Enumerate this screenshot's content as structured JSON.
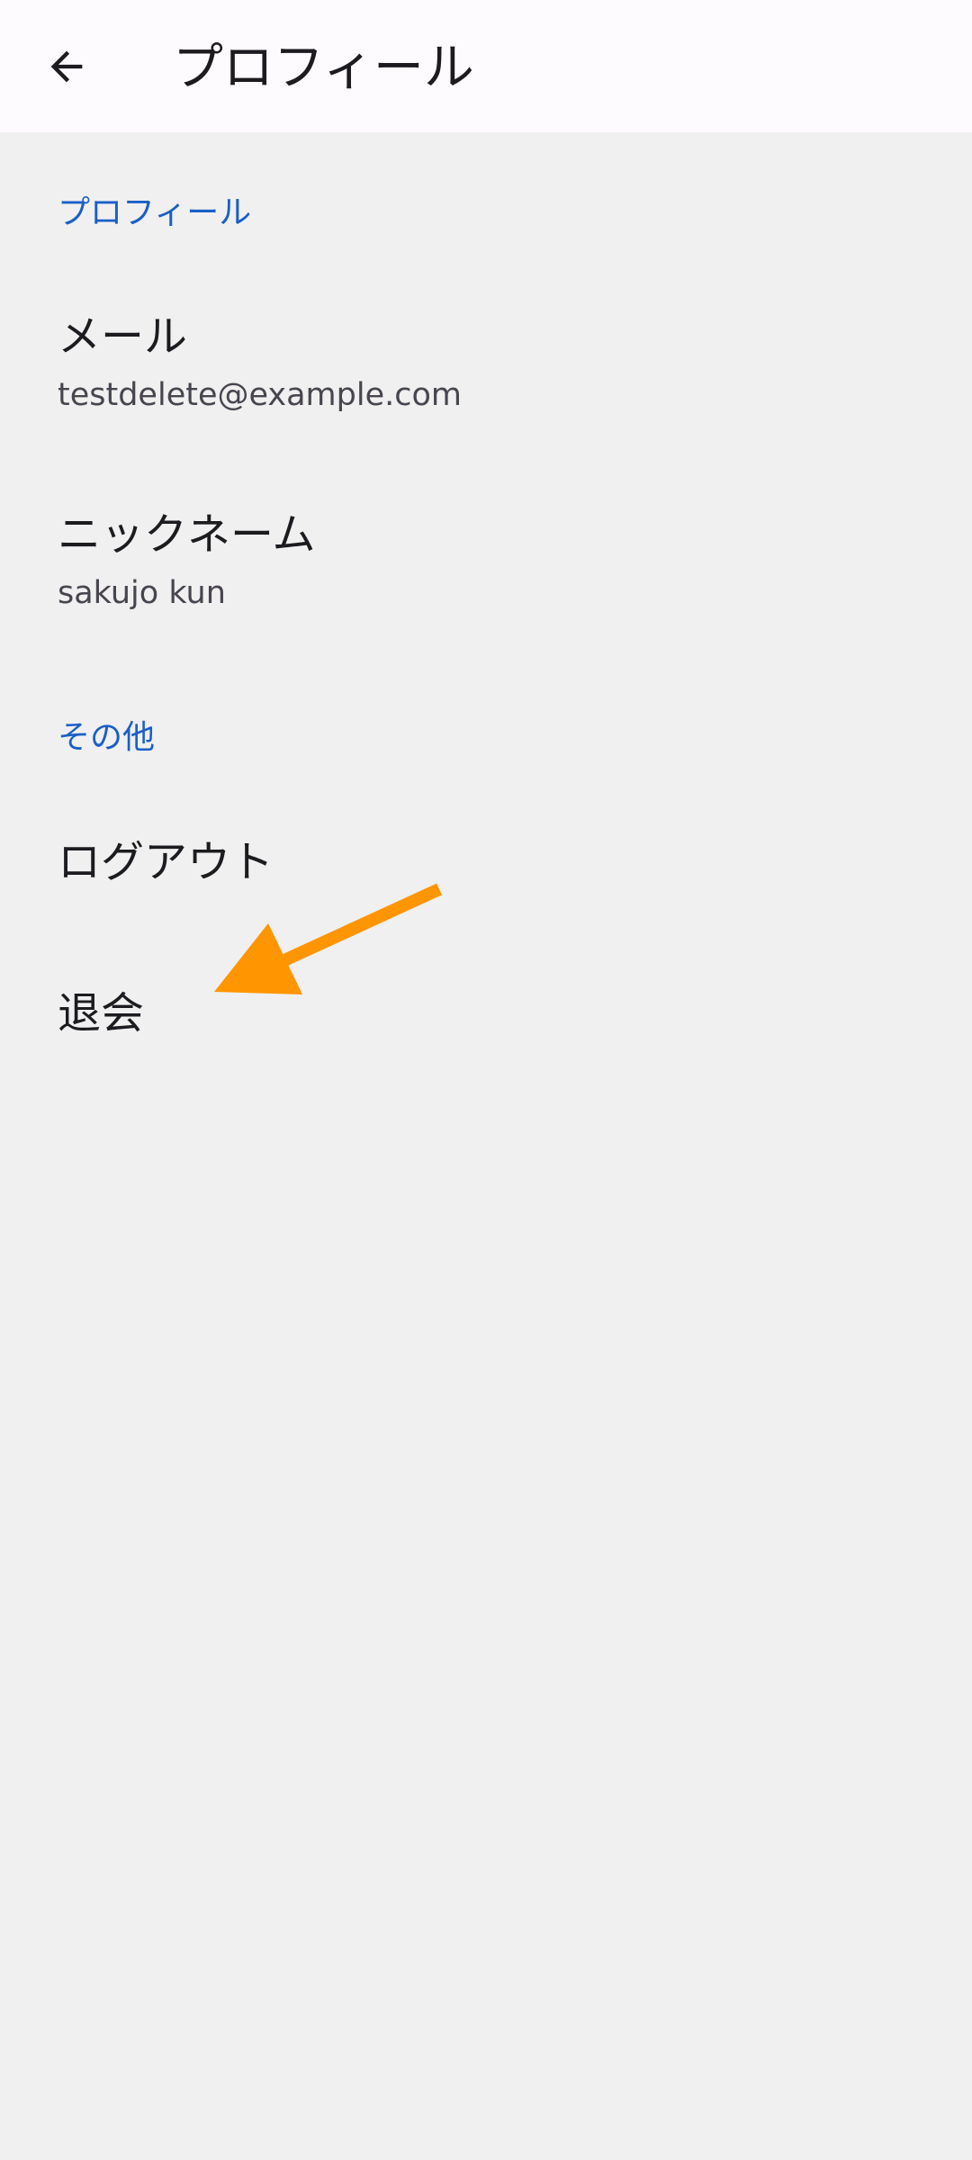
{
  "app_bar": {
    "title": "プロフィール",
    "back_icon": "arrow-back-icon"
  },
  "sections": {
    "profile": {
      "header": "プロフィール",
      "email": {
        "title": "メール",
        "value": "testdelete@example.com"
      },
      "nickname": {
        "title": "ニックネーム",
        "value": "sakujo kun"
      }
    },
    "other": {
      "header": "その他",
      "logout": {
        "title": "ログアウト"
      },
      "withdraw": {
        "title": "退会"
      }
    }
  },
  "annotation": {
    "icon": "arrow-annotation-icon",
    "color": "#ff9500"
  },
  "colors": {
    "app_bar_bg": "#fefbfe",
    "page_bg": "#f0f0f0",
    "accent": "#1a5fc7",
    "text_primary": "#1c1b1f",
    "text_secondary": "#49454f"
  }
}
